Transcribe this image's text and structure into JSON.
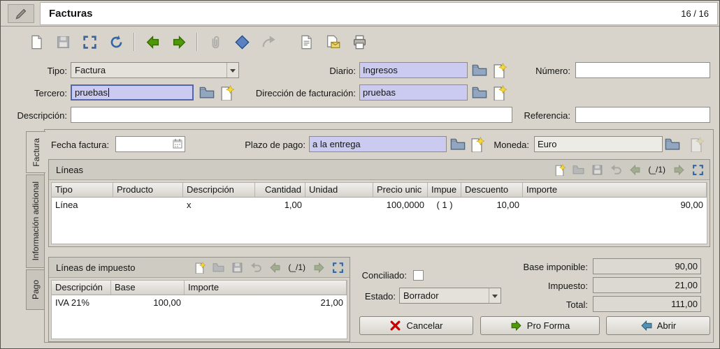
{
  "header": {
    "title": "Facturas",
    "counter": "16 / 16"
  },
  "toolbar": {
    "items": [
      "new",
      "save",
      "switch-view",
      "reload",
      "previous",
      "next",
      "attachment",
      "action",
      "relate",
      "report",
      "email",
      "print"
    ]
  },
  "form": {
    "tipo_label": "Tipo:",
    "tipo_value": "Factura",
    "diario_label": "Diario:",
    "diario_value": "Ingresos",
    "numero_label": "Número:",
    "numero_value": "",
    "tercero_label": "Tercero:",
    "tercero_value": "pruebas",
    "direccion_label": "Dirección de facturación:",
    "direccion_value": "pruebas",
    "descripcion_label": "Descripción:",
    "descripcion_value": "",
    "referencia_label": "Referencia:",
    "referencia_value": ""
  },
  "tabs": {
    "factura": "Factura",
    "informacion_adicional": "Información adicional",
    "pago": "Pago"
  },
  "invoice": {
    "fecha_label": "Fecha factura:",
    "fecha_value": "",
    "plazo_label": "Plazo de pago:",
    "plazo_value": "a la entrega",
    "moneda_label": "Moneda:",
    "moneda_value": "Euro",
    "lines": {
      "title": "Líneas",
      "pager": "(_/1)",
      "columns": [
        "Tipo",
        "Producto",
        "Descripción",
        "Cantidad",
        "Unidad",
        "Precio unic",
        "Impue",
        "Descuento",
        "Importe"
      ],
      "rows": [
        [
          "Línea",
          "",
          "x",
          "1,00",
          "",
          "100,0000",
          "( 1 )",
          "10,00",
          "90,00"
        ]
      ]
    },
    "tax_lines": {
      "title": "Líneas de impuesto",
      "pager": "(_/1)",
      "columns": [
        "Descripción",
        "Base",
        "Importe"
      ],
      "rows": [
        [
          "IVA 21%",
          "100,00",
          "21,00"
        ]
      ]
    },
    "conciliado_label": "Conciliado:",
    "estado_label": "Estado:",
    "estado_value": "Borrador",
    "totals": {
      "base_label": "Base imponible:",
      "base_value": "90,00",
      "impuesto_label": "Impuesto:",
      "impuesto_value": "21,00",
      "total_label": "Total:",
      "total_value": "111,00"
    },
    "buttons": {
      "cancelar": "Cancelar",
      "pro_forma": "Pro Forma",
      "abrir": "Abrir"
    }
  }
}
